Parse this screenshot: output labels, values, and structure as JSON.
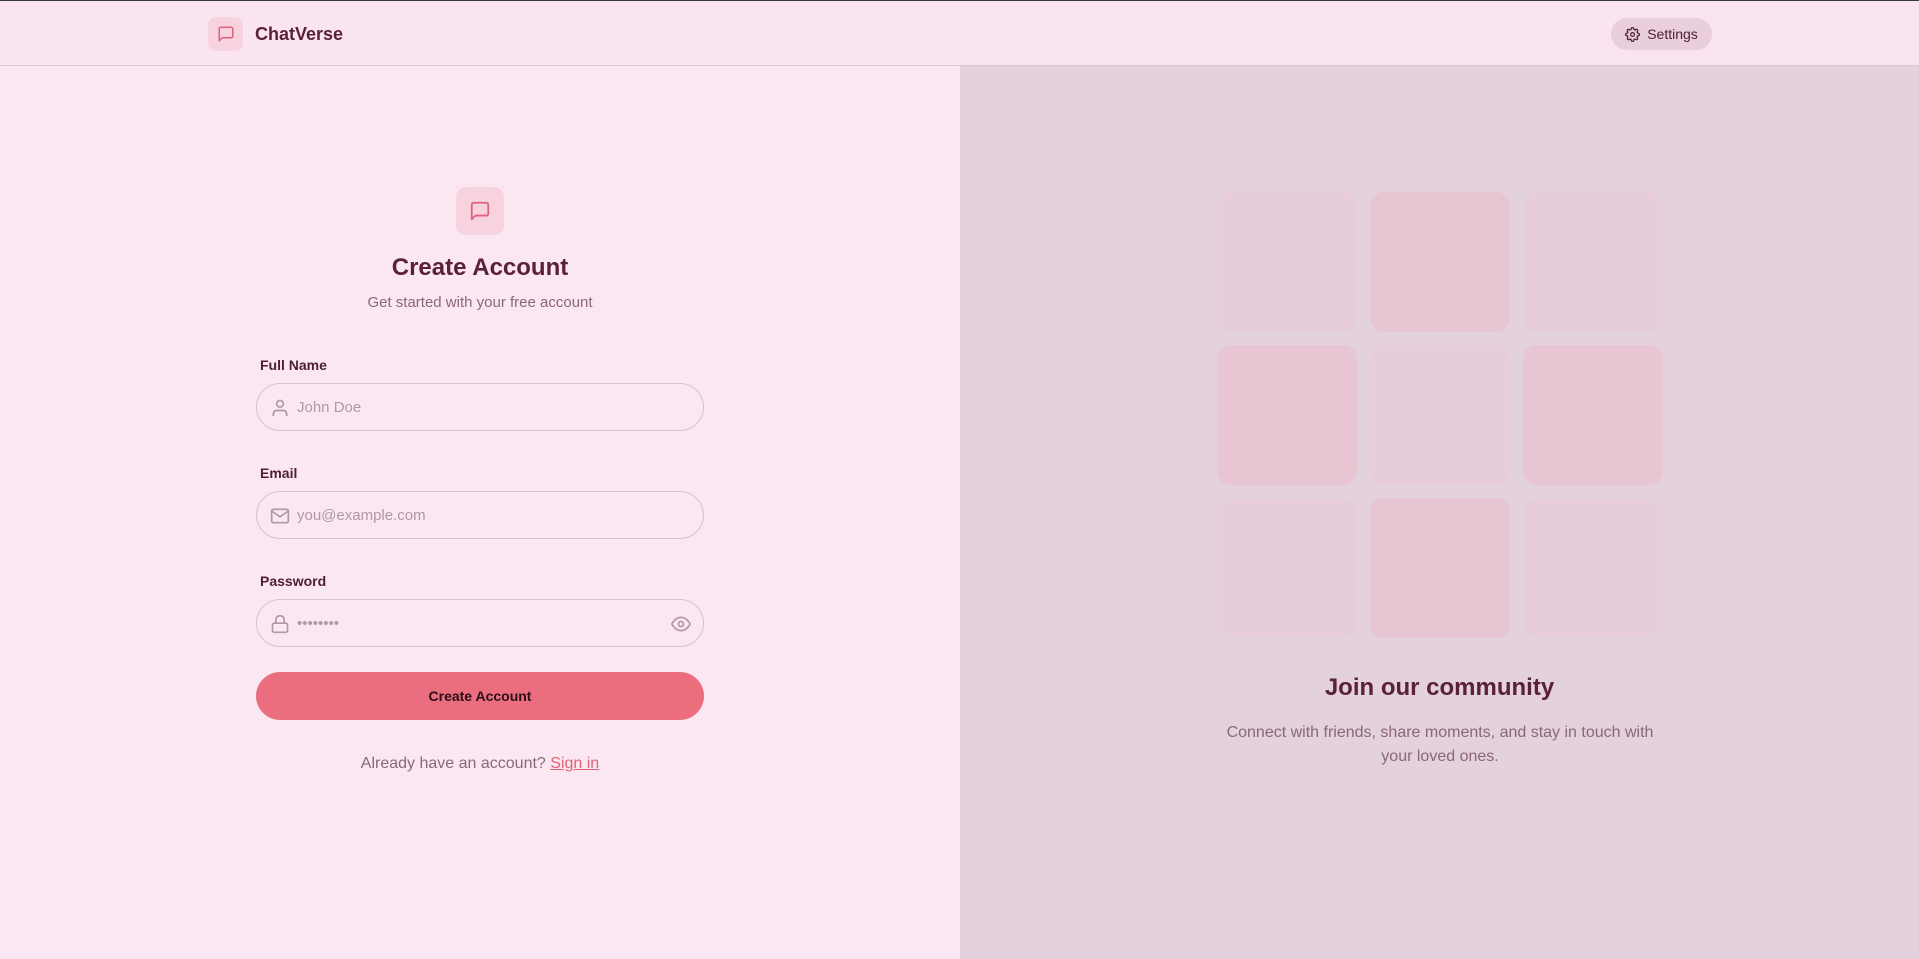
{
  "header": {
    "brand_name": "ChatVerse",
    "settings_label": "Settings"
  },
  "form": {
    "title": "Create Account",
    "subtitle": "Get started with your free account",
    "full_name": {
      "label": "Full Name",
      "placeholder": "John Doe",
      "value": ""
    },
    "email": {
      "label": "Email",
      "placeholder": "you@example.com",
      "value": ""
    },
    "password": {
      "label": "Password",
      "placeholder": "••••••••",
      "value": ""
    },
    "submit_label": "Create Account",
    "signin_prompt": "Already have an account?",
    "signin_link": "Sign in"
  },
  "promo": {
    "title": "Join our community",
    "text": "Connect with friends, share moments, and stay in touch with your loved ones.",
    "tiles": [
      "light",
      "dark",
      "light",
      "dark",
      "light",
      "dark",
      "light",
      "dark",
      "light"
    ]
  },
  "colors": {
    "accent": "#eb6e7f",
    "text_primary": "#5b2136",
    "text_muted": "#8a6878",
    "background_left": "#fbe7f2",
    "background_right": "#e3d1dc"
  },
  "icons": {
    "brand": "message-square-icon",
    "settings": "gear-icon",
    "form_header": "message-square-icon",
    "full_name": "user-icon",
    "email": "mail-icon",
    "password": "lock-icon",
    "password_toggle": "eye-icon"
  }
}
